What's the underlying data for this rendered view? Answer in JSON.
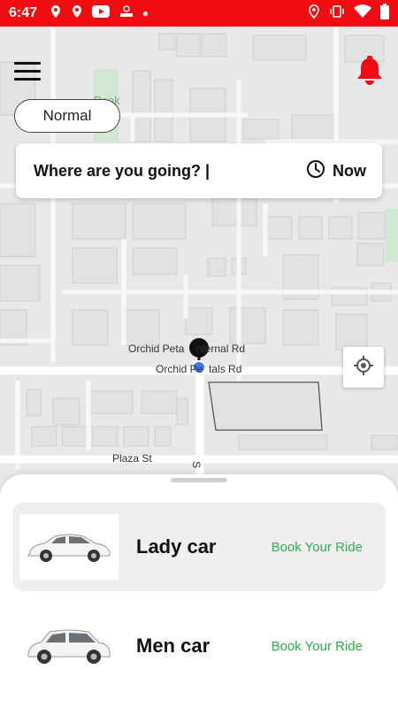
{
  "status_bar": {
    "time": "6:47",
    "left_icons": [
      "location-pin-icon",
      "location-pin-icon",
      "youtube-icon",
      "app-icon",
      "dot"
    ],
    "right_icons": [
      "location-icon",
      "vibrate-icon",
      "wifi-icon",
      "battery-icon"
    ]
  },
  "map": {
    "roads": [
      {
        "name": "Orchid Petals Internal Rd",
        "display": "Orchid Peta    nternal Rd"
      },
      {
        "name": "Orchid Petals Rd",
        "display": "Orchid Pe  tals Rd"
      },
      {
        "name": "Plaza St",
        "display": "Plaza St"
      },
      {
        "name": "S",
        "display": "S"
      }
    ],
    "place_label": "Pook"
  },
  "header": {
    "menu_icon": "hamburger-menu-icon",
    "notification_icon": "bell-icon"
  },
  "mode": {
    "label": "Normal"
  },
  "search": {
    "placeholder": "Where are you going?",
    "query_display": "Where are you going? |",
    "time_option": "Now",
    "time_icon": "clock-icon"
  },
  "locate_icon": "my-location-icon",
  "rides": [
    {
      "name": "Lady car",
      "action": "Book Your Ride",
      "selected": true,
      "icon": "sedan-car-icon"
    },
    {
      "name": "Men car",
      "action": "Book Your Ride",
      "selected": false,
      "icon": "suv-car-icon"
    }
  ],
  "colors": {
    "accent": "#ef0d12",
    "book_text": "#2bb24c",
    "selected_row": "#efefef"
  }
}
